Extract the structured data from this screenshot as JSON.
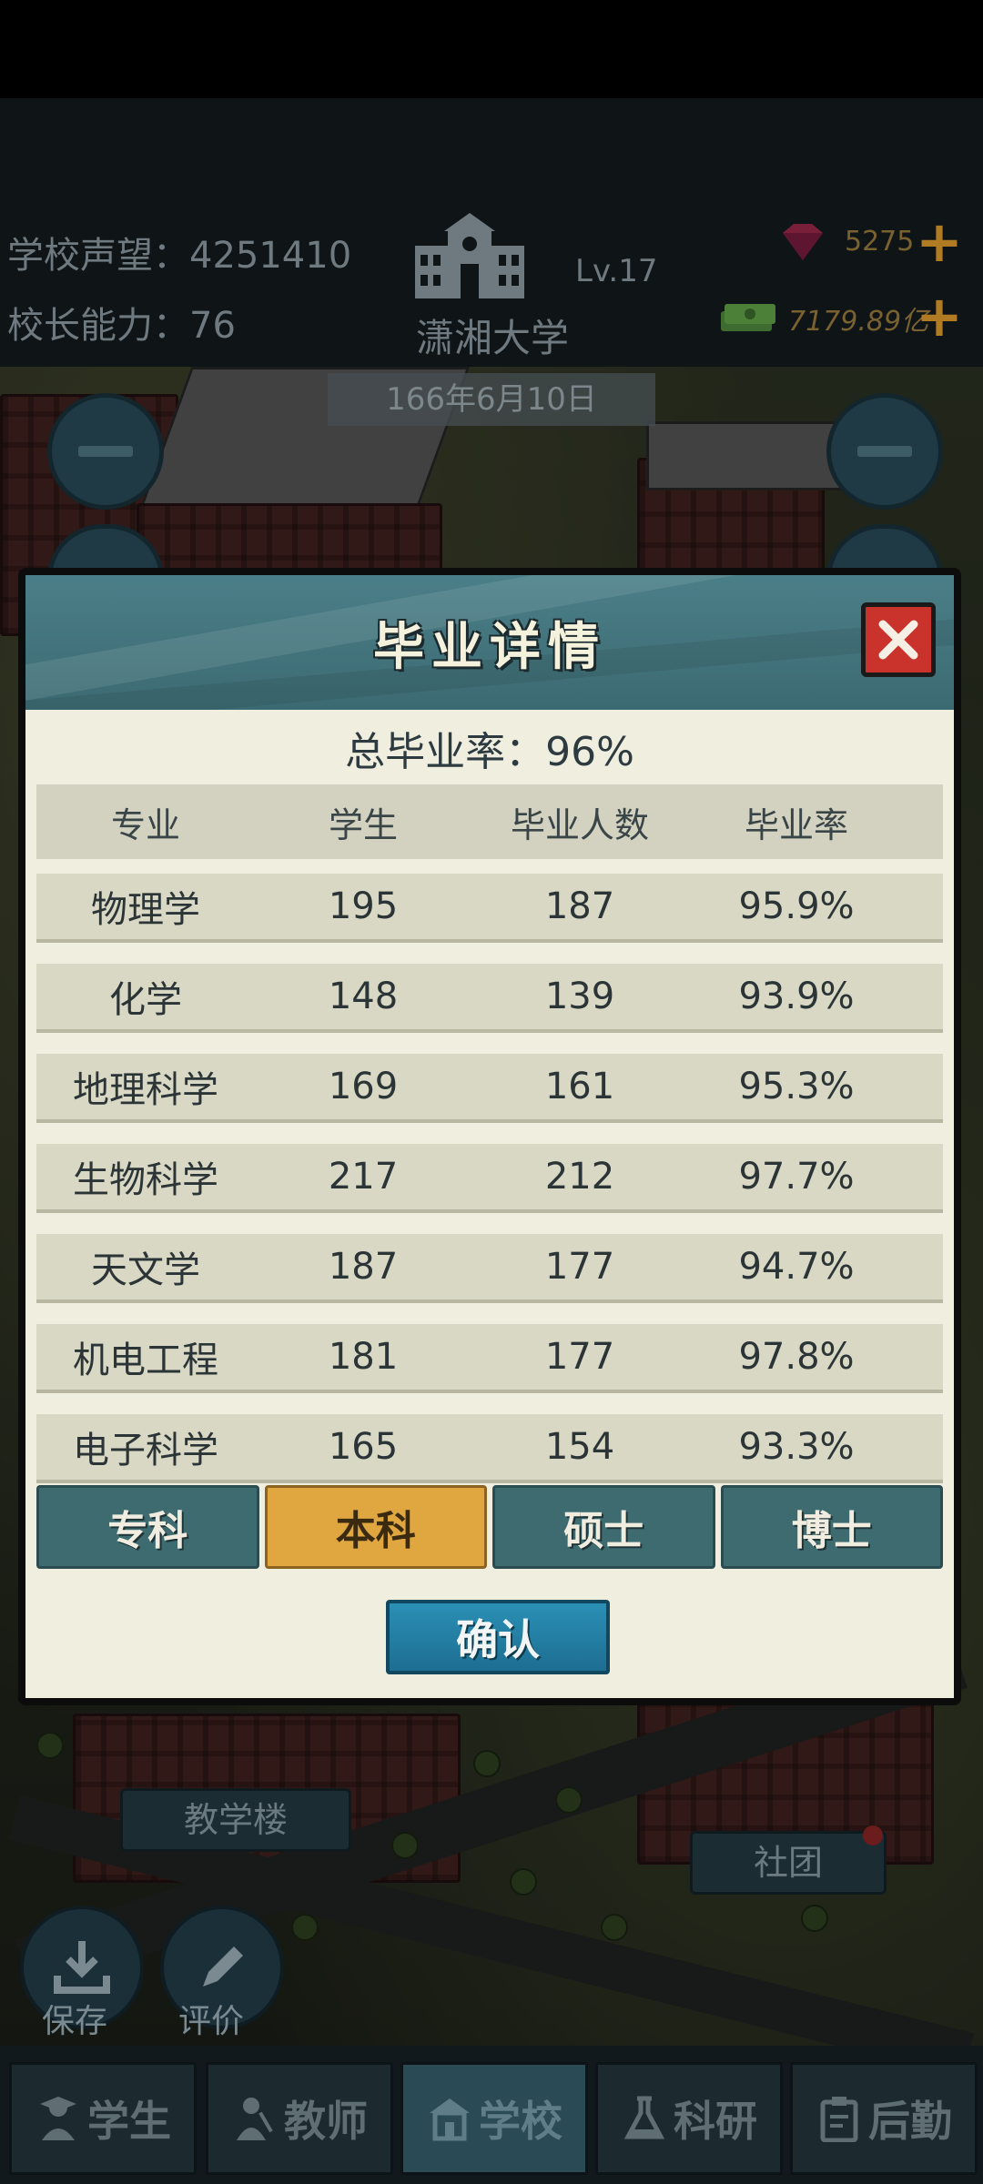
{
  "hud": {
    "prestige": "学校声望：4251410",
    "ability": "校长能力：76",
    "level": "Lv.17",
    "school_name": "潇湘大学",
    "date": "166年6月10日",
    "gems": "5275",
    "money": "7179.89亿"
  },
  "map": {
    "teaching_building": "教学楼",
    "club": "社团",
    "save": "保存",
    "rate": "评价"
  },
  "modal": {
    "title": "毕业详情",
    "total_rate": "总毕业率：96%",
    "headers": [
      "专业",
      "学生",
      "毕业人数",
      "毕业率"
    ],
    "rows": [
      [
        "物理学",
        "195",
        "187",
        "95.9%"
      ],
      [
        "化学",
        "148",
        "139",
        "93.9%"
      ],
      [
        "地理科学",
        "169",
        "161",
        "95.3%"
      ],
      [
        "生物科学",
        "217",
        "212",
        "97.7%"
      ],
      [
        "天文学",
        "187",
        "177",
        "94.7%"
      ],
      [
        "机电工程",
        "181",
        "177",
        "97.8%"
      ],
      [
        "电子科学",
        "165",
        "154",
        "93.3%"
      ]
    ],
    "degree_tabs": [
      "专科",
      "本科",
      "硕士",
      "博士"
    ],
    "active_tab": "本科",
    "confirm": "确认"
  },
  "tabbar": {
    "tabs": [
      "学生",
      "教师",
      "学校",
      "科研",
      "后勤"
    ],
    "active": "学校"
  },
  "colors": {
    "modal_header": "#3c6a72",
    "active_tab": "#e0a640",
    "confirm": "#2b8fb5",
    "close": "#c9332b"
  }
}
